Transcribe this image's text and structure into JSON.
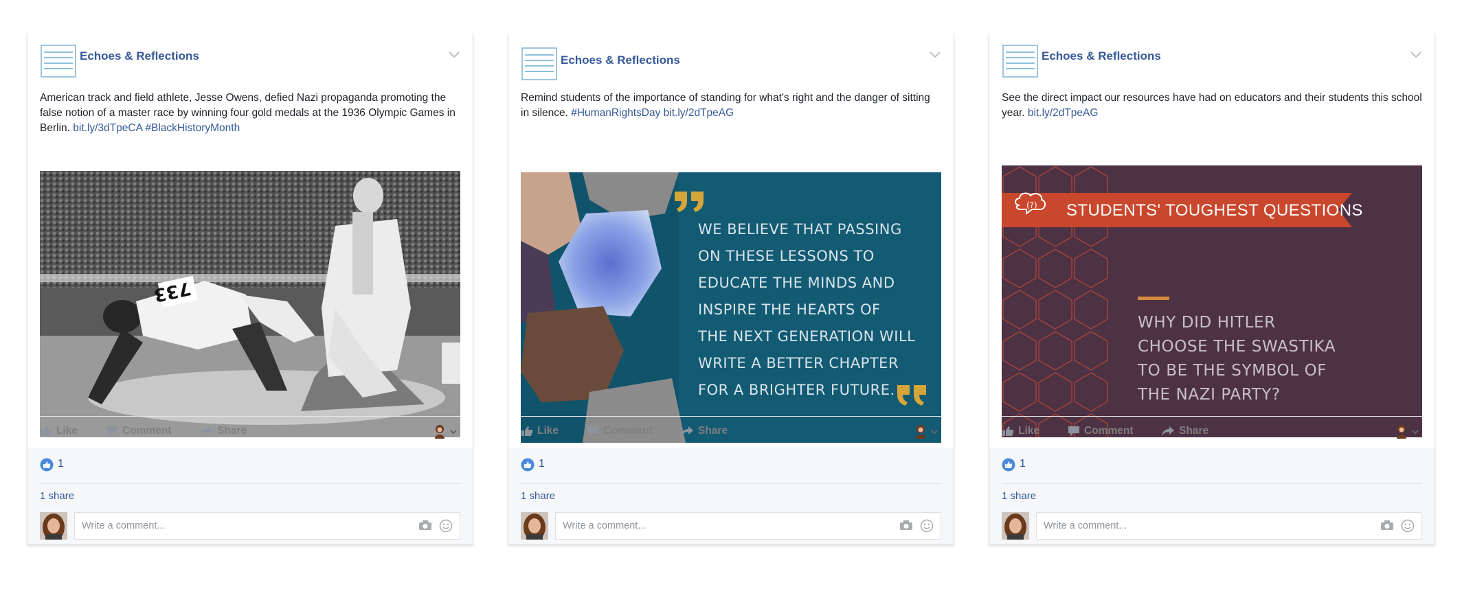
{
  "posts": [
    {
      "page_name": "Echoes & Reflections",
      "text": "American track and field athlete, Jesse Owens, defied Nazi propaganda promoting the false notion of a master race by winning four gold medals at the 1936 Olympic Games in Berlin. ",
      "links": [
        "bit.ly/3dTpeCA",
        "#BlackHistoryMonth"
      ],
      "image": {
        "bib": "733"
      },
      "actions": {
        "like": "Like",
        "comment": "Comment",
        "share": "Share"
      },
      "like_count": "1",
      "shares": "1 share",
      "comment_placeholder": "Write a comment..."
    },
    {
      "page_name": "Echoes & Reflections",
      "text": "Remind students of the importance of standing for what's right and the danger of sitting in silence. ",
      "links": [
        "#HumanRightsDay",
        "bit.ly/2dTpeAG"
      ],
      "image": {
        "quote_lines": [
          "WE BELIEVE THAT PASSING",
          "ON THESE LESSONS TO",
          "EDUCATE THE MINDS AND",
          "INSPIRE THE HEARTS OF",
          "THE NEXT GENERATION WILL",
          "WRITE A BETTER CHAPTER",
          "FOR A BRIGHTER FUTURE."
        ]
      },
      "actions": {
        "like": "Like",
        "comment": "Comment",
        "share": "Share"
      },
      "like_count": "1",
      "shares": "1 share",
      "comment_placeholder": "Write a comment..."
    },
    {
      "page_name": "Echoes & Reflections",
      "text": "See the direct impact our resources have had on educators and their students this school year. ",
      "links": [
        "bit.ly/2dTpeAG"
      ],
      "image": {
        "banner": "STUDENTS' TOUGHEST QUESTIONS",
        "question_lines": [
          "WHY DID HITLER",
          "CHOOSE THE SWASTIKA",
          "TO BE THE SYMBOL OF",
          "THE NAZI PARTY?"
        ]
      },
      "actions": {
        "like": "Like",
        "comment": "Comment",
        "share": "Share"
      },
      "like_count": "1",
      "shares": "1 share",
      "comment_placeholder": "Write a comment..."
    }
  ],
  "colors": {
    "link": "#365899",
    "teal": "#135a73",
    "plum": "#4d3244",
    "banner_red": "#c9472c",
    "quote_gold": "#d6a53a"
  },
  "icons": [
    "page-logo-icon",
    "chevron-down-icon",
    "thumbs-up-icon",
    "comment-icon",
    "share-icon",
    "audience-avatar-icon",
    "like-reaction-icon",
    "camera-icon",
    "emoji-icon"
  ]
}
